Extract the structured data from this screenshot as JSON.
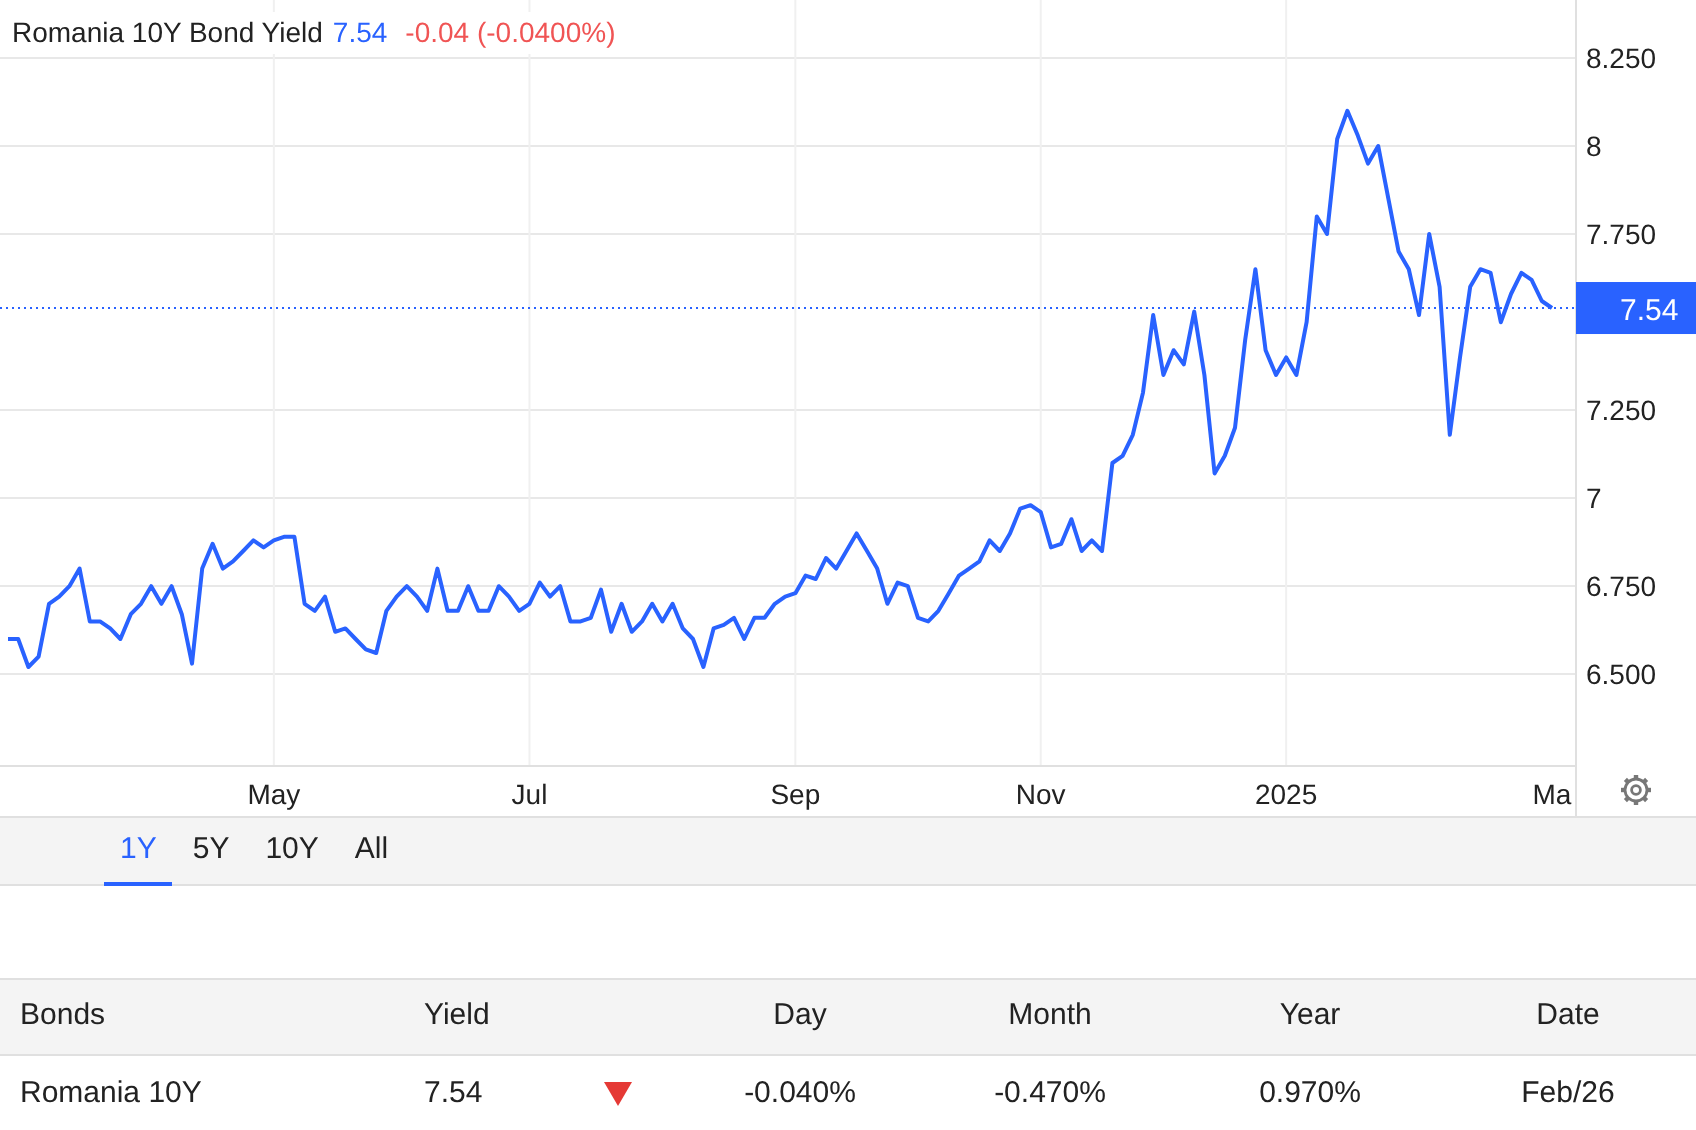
{
  "title": {
    "name": "Romania 10Y Bond Yield",
    "price": "7.54",
    "change": "-0.04 (-0.0400%)"
  },
  "chart": {
    "chart_data": {
      "type": "line",
      "grid": true,
      "ylim": [
        6.239,
        8.415
      ],
      "ref_lines": [
        {
          "axis": "y",
          "value": 7.54,
          "label": "7.54",
          "color": "#2962ff"
        }
      ],
      "categories": [
        null,
        null,
        null,
        null,
        null,
        null,
        null,
        null,
        null,
        null,
        null,
        null,
        null,
        null,
        null,
        null,
        null,
        null,
        null,
        null,
        null,
        null,
        null,
        null,
        null,
        null,
        "May",
        null,
        null,
        null,
        null,
        null,
        null,
        null,
        null,
        null,
        null,
        null,
        null,
        null,
        null,
        null,
        null,
        null,
        null,
        null,
        null,
        null,
        null,
        null,
        null,
        "Jul",
        null,
        null,
        null,
        null,
        null,
        null,
        null,
        null,
        null,
        null,
        null,
        null,
        null,
        null,
        null,
        null,
        null,
        null,
        null,
        null,
        null,
        null,
        null,
        null,
        null,
        "Sep",
        null,
        null,
        null,
        null,
        null,
        null,
        null,
        null,
        null,
        null,
        null,
        null,
        null,
        null,
        null,
        null,
        null,
        null,
        null,
        null,
        null,
        null,
        null,
        "Nov",
        null,
        null,
        null,
        null,
        null,
        null,
        null,
        null,
        null,
        null,
        null,
        null,
        null,
        null,
        null,
        null,
        null,
        null,
        null,
        null,
        null,
        null,
        null,
        "2025",
        null,
        null,
        null,
        null,
        null,
        null,
        null,
        null,
        null,
        null,
        null,
        null,
        null,
        null,
        null,
        null,
        null,
        null,
        null,
        null,
        null,
        null,
        null,
        null,
        null,
        "Ma"
      ],
      "series": [
        {
          "color": "#2962ff",
          "values": [
            6.6,
            6.6,
            6.52,
            6.55,
            6.7,
            6.72,
            6.75,
            6.8,
            6.65,
            6.65,
            6.63,
            6.6,
            6.67,
            6.7,
            6.75,
            6.7,
            6.75,
            6.67,
            6.53,
            6.8,
            6.87,
            6.8,
            6.82,
            6.85,
            6.88,
            6.86,
            6.88,
            6.89,
            6.89,
            6.7,
            6.68,
            6.72,
            6.62,
            6.63,
            6.6,
            6.57,
            6.56,
            6.68,
            6.72,
            6.75,
            6.72,
            6.68,
            6.8,
            6.68,
            6.68,
            6.75,
            6.68,
            6.68,
            6.75,
            6.72,
            6.68,
            6.7,
            6.76,
            6.72,
            6.75,
            6.65,
            6.65,
            6.66,
            6.74,
            6.62,
            6.7,
            6.62,
            6.65,
            6.7,
            6.65,
            6.7,
            6.63,
            6.6,
            6.52,
            6.63,
            6.64,
            6.66,
            6.6,
            6.66,
            6.66,
            6.7,
            6.72,
            6.73,
            6.78,
            6.77,
            6.83,
            6.8,
            6.85,
            6.9,
            6.85,
            6.8,
            6.7,
            6.76,
            6.75,
            6.66,
            6.65,
            6.68,
            6.73,
            6.78,
            6.8,
            6.82,
            6.88,
            6.85,
            6.9,
            6.97,
            6.98,
            6.96,
            6.86,
            6.87,
            6.94,
            6.85,
            6.88,
            6.85,
            7.1,
            7.12,
            7.18,
            7.3,
            7.52,
            7.35,
            7.42,
            7.38,
            7.53,
            7.35,
            7.07,
            7.12,
            7.2,
            7.45,
            7.65,
            7.42,
            7.35,
            7.4,
            7.35,
            7.5,
            7.8,
            7.75,
            8.02,
            8.1,
            8.03,
            7.95,
            8.0,
            7.85,
            7.7,
            7.65,
            7.52,
            7.75,
            7.6,
            7.18,
            7.4,
            7.6,
            7.65,
            7.64,
            7.5,
            7.58,
            7.64,
            7.62,
            7.56,
            7.54
          ]
        }
      ],
      "yticks": [
        {
          "value": 8.25,
          "label": "8.250"
        },
        {
          "value": 8,
          "label": "8"
        },
        {
          "value": 7.75,
          "label": "7.750"
        },
        {
          "value": 7.25,
          "label": "7.250"
        },
        {
          "value": 7,
          "label": "7"
        },
        {
          "value": 6.75,
          "label": "6.750"
        },
        {
          "value": 6.5,
          "label": "6.500"
        }
      ]
    }
  },
  "ranges": [
    {
      "label": "1Y",
      "selected": true
    },
    {
      "label": "5Y",
      "selected": false
    },
    {
      "label": "10Y",
      "selected": false
    },
    {
      "label": "All",
      "selected": false
    }
  ],
  "table": {
    "columns": [
      "Bonds",
      "Yield",
      "Day",
      "Month",
      "Year",
      "Date"
    ],
    "rows": [
      {
        "name": "Romania 10Y",
        "yield": "7.54",
        "kind": "down",
        "day": "-0.040%",
        "month": "-0.470%",
        "year": "0.970%",
        "date": "Feb/26"
      }
    ]
  }
}
